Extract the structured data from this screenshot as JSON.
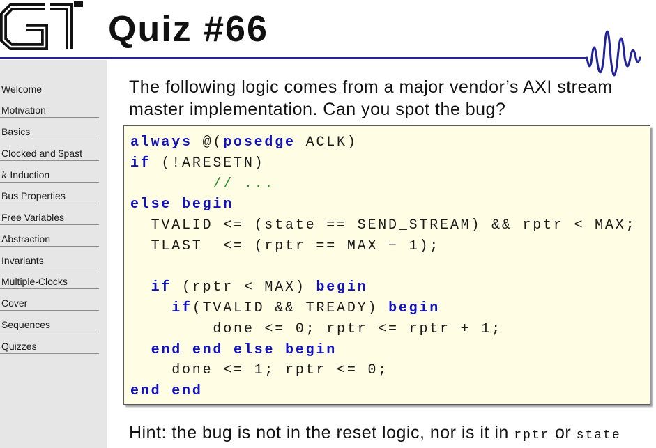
{
  "logo": {
    "text": "GT",
    "icon": "gt-logo"
  },
  "title": "Quiz #66",
  "colors": {
    "accent": "#22229a",
    "keyword": "#1111c4",
    "comment": "#2a8f2a",
    "code_background": "#fffde3"
  },
  "sidebar": {
    "items": [
      {
        "label": "Welcome"
      },
      {
        "label": "Motivation"
      },
      {
        "label": "Basics"
      },
      {
        "label": "Clocked and $past"
      },
      {
        "prefix": "k",
        "label": "Induction"
      },
      {
        "label": "Bus Properties"
      },
      {
        "label": "Free Variables"
      },
      {
        "label": "Abstraction"
      },
      {
        "label": "Invariants"
      },
      {
        "label": "Multiple-Clocks"
      },
      {
        "label": "Cover"
      },
      {
        "label": "Sequences"
      },
      {
        "label": "Quizzes"
      }
    ]
  },
  "intro": {
    "lines": [
      "The following logic comes from a major vendor’s AXI stream",
      "master implementation. Can you spot the bug?"
    ]
  },
  "code": {
    "lines": [
      [
        {
          "text": "always",
          "style": "keyword"
        },
        {
          "text": " @(",
          "style": "plain"
        },
        {
          "text": "posedge",
          "style": "keyword"
        },
        {
          "text": " ACLK)",
          "style": "plain"
        }
      ],
      [
        {
          "text": "if",
          "style": "keyword"
        },
        {
          "text": " (!ARESETN)",
          "style": "plain"
        }
      ],
      [
        {
          "text": "        ",
          "style": "plain"
        },
        {
          "text": "// ...",
          "style": "comment"
        }
      ],
      [
        {
          "text": "else",
          "style": "keyword"
        },
        {
          "text": " ",
          "style": "plain"
        },
        {
          "text": "begin",
          "style": "keyword"
        }
      ],
      [
        {
          "text": "  TVALID <= (state == SEND_STREAM) && rptr < MAX;",
          "style": "plain"
        }
      ],
      [
        {
          "text": "  TLAST  <= (rptr == MAX − 1);",
          "style": "plain"
        }
      ],
      [],
      [
        {
          "text": "  ",
          "style": "plain"
        },
        {
          "text": "if",
          "style": "keyword"
        },
        {
          "text": " (rptr < MAX) ",
          "style": "plain"
        },
        {
          "text": "begin",
          "style": "keyword"
        }
      ],
      [
        {
          "text": "    ",
          "style": "plain"
        },
        {
          "text": "if",
          "style": "keyword"
        },
        {
          "text": "(TVALID && TREADY) ",
          "style": "plain"
        },
        {
          "text": "begin",
          "style": "keyword"
        }
      ],
      [
        {
          "text": "        done <= 0; rptr <= rptr + 1;",
          "style": "plain"
        }
      ],
      [
        {
          "text": "  ",
          "style": "plain"
        },
        {
          "text": "end",
          "style": "keyword"
        },
        {
          "text": " ",
          "style": "plain"
        },
        {
          "text": "end",
          "style": "keyword"
        },
        {
          "text": " ",
          "style": "plain"
        },
        {
          "text": "else",
          "style": "keyword"
        },
        {
          "text": " ",
          "style": "plain"
        },
        {
          "text": "begin",
          "style": "keyword"
        }
      ],
      [
        {
          "text": "    done <= 1; rptr <= 0;",
          "style": "plain"
        }
      ],
      [
        {
          "text": "end",
          "style": "keyword"
        },
        {
          "text": " ",
          "style": "plain"
        },
        {
          "text": "end",
          "style": "keyword"
        }
      ]
    ]
  },
  "hint": {
    "prefix": "Hint: the bug is not in the reset logic, nor is it in",
    "code1": "rptr",
    "mid": "or",
    "code2": "state"
  }
}
